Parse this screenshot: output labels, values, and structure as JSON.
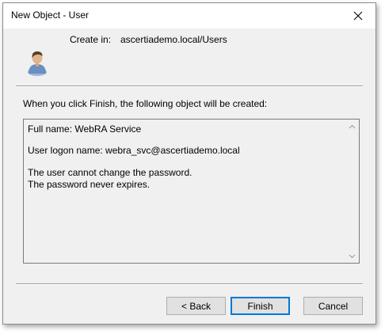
{
  "window": {
    "title": "New Object - User",
    "close_icon": "close-icon"
  },
  "header": {
    "icon": "user-icon",
    "create_in_label": "Create in:",
    "create_in_value": "ascertiademo.local/Users"
  },
  "main": {
    "description": "When you click Finish, the following object will be created:",
    "summary_lines": [
      "Full name: WebRA Service",
      "User logon name: webra_svc@ascertiademo.local",
      "The user cannot change the password.",
      "The password never expires."
    ]
  },
  "buttons": {
    "back": "< Back",
    "finish": "Finish",
    "cancel": "Cancel"
  },
  "colors": {
    "dialog_bg": "#f0f0f0",
    "default_button_border": "#0078d7"
  }
}
